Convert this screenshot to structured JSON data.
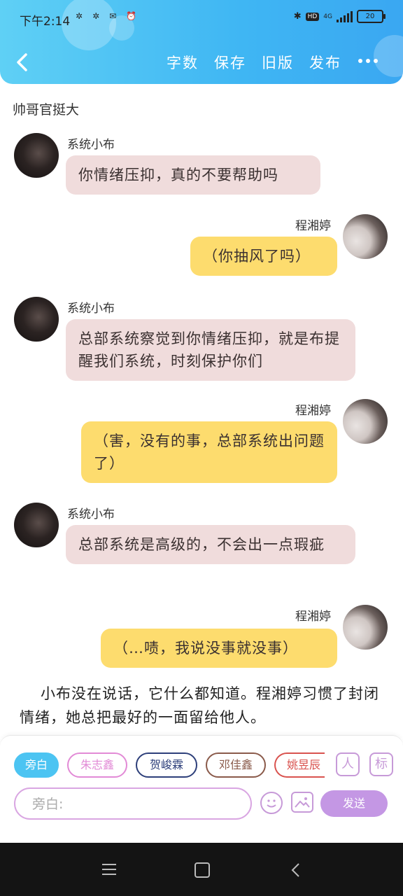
{
  "status_bar": {
    "time": "下午2:14",
    "left_icons": [
      "settings-icon",
      "settings-icon",
      "message-icon",
      "alarm-icon"
    ],
    "hd": "HD",
    "network": "4G",
    "battery": "20"
  },
  "header": {
    "toolbar": [
      "字数",
      "保存",
      "旧版",
      "发布"
    ]
  },
  "chat": {
    "title": "帅哥官挺大",
    "messages": [
      {
        "side": "left",
        "sender": "系统小布",
        "text": "你情绪压抑，真的不要帮助吗"
      },
      {
        "side": "right",
        "sender": "程湘婷",
        "text": "（你抽风了吗）"
      },
      {
        "side": "left",
        "sender": "系统小布",
        "text": "总部系统察觉到你情绪压抑，就是布提醒我们系统，时刻保护你们"
      },
      {
        "side": "right",
        "sender": "程湘婷",
        "text": "（害，没有的事，总部系统出问题了）"
      },
      {
        "side": "left",
        "sender": "系统小布",
        "text": "总部系统是高级的，不会出一点瑕疵"
      },
      {
        "side": "right",
        "sender": "程湘婷",
        "text": "（…啧，我说没事就没事）"
      }
    ],
    "narration": "小布没在说话，它什么都知道。程湘婷习惯了封闭情绪，她总把最好的一面留给他人。"
  },
  "composer": {
    "roles": [
      {
        "label": "旁白",
        "color": "#4cc4f2",
        "active": true
      },
      {
        "label": "朱志鑫",
        "color": "#e28ad6",
        "active": false
      },
      {
        "label": "贺峻霖",
        "color": "#2d3f7a",
        "active": false
      },
      {
        "label": "邓佳鑫",
        "color": "#8a5a4a",
        "active": false
      },
      {
        "label": "姚昱辰",
        "color": "#d9534f",
        "active": false
      }
    ],
    "role_icon_text": "人",
    "tag_icon_text": "标",
    "input_placeholder": "旁白:",
    "send_label": "发送"
  }
}
